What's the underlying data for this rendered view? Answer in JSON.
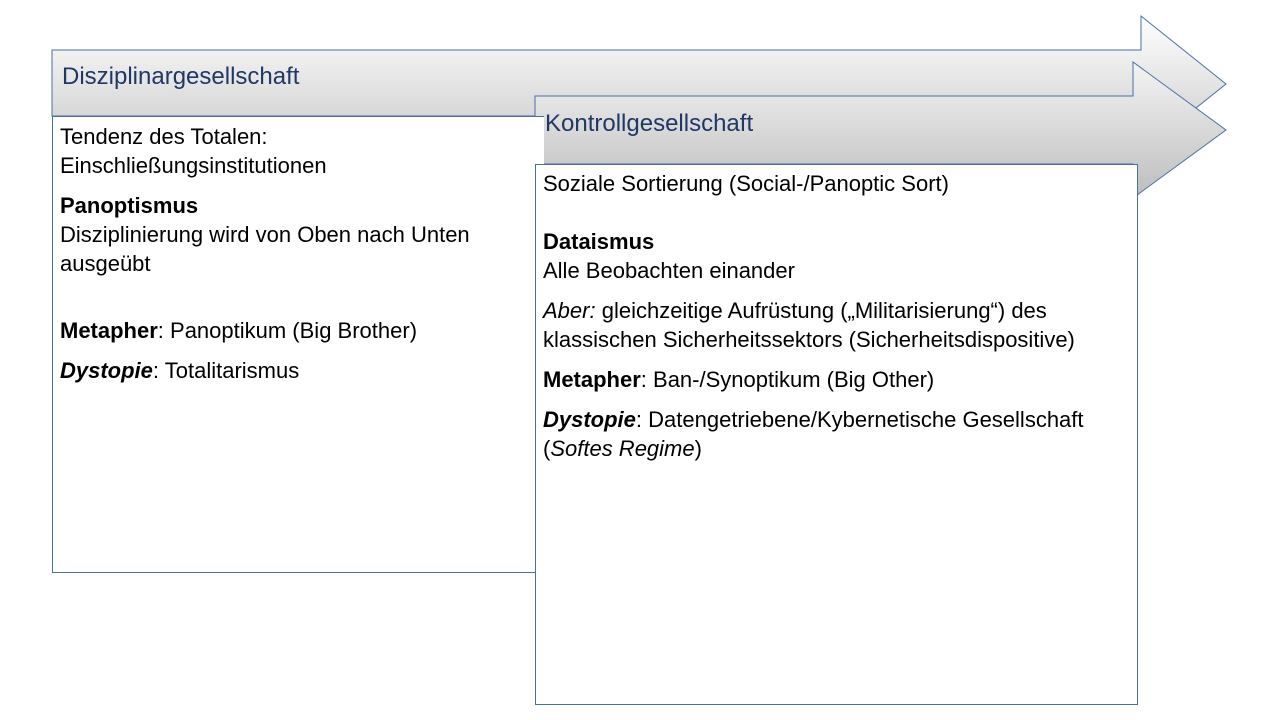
{
  "disziplinar": {
    "title": "Disziplinargesellschaft",
    "p1_line1": "Tendenz des Totalen:",
    "p1_line2": "Einschließungsinstitutionen",
    "panoptismus_label": "Panoptismus",
    "panoptismus_text": "Disziplinierung wird von Oben nach Unten ausgeübt",
    "metapher_label": "Metapher",
    "metapher_text": ": Panoptikum (Big Brother)",
    "dystopie_label": "Dystopie",
    "dystopie_text": ": Totalitarismus"
  },
  "kontroll": {
    "title": "Kontrollgesellschaft",
    "p1": "Soziale Sortierung (Social-/Panoptic Sort)",
    "dataismus_label": "Dataismus",
    "dataismus_text": "Alle Beobachten einander",
    "aber_label": "Aber:",
    "aber_text": " gleichzeitige Aufrüstung („Militarisierung“) des klassischen Sicherheitssektors (Sicherheitsdispositive)",
    "metapher_label": "Metapher",
    "metapher_text": ": Ban-/Synoptikum (Big Other)",
    "dystopie_label": "Dystopie",
    "dystopie_text1": ": Datengetriebene/Kybernetische Gesellschaft (",
    "dystopie_italic": "Softes Regime",
    "dystopie_text2": ")"
  },
  "colors": {
    "title_text": "#1f3864",
    "border": "#4a6fa5",
    "arrow_gradient_top": "#ffffff",
    "arrow_gradient_bottom": "#c8c8c8"
  }
}
